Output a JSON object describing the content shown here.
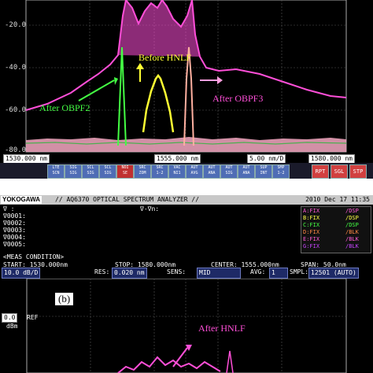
{
  "top": {
    "y_ticks": [
      "-20.0",
      "-40.0",
      "-60.0",
      "-80.0"
    ],
    "x_start": "1530.000",
    "x_center": "1555.000",
    "x_span_div": "5.00",
    "x_end": "1580.000",
    "x_unit": "nm",
    "x_div_unit": "nm/D",
    "annotations": {
      "before_hnlf": "Before HNLF",
      "after_obpf2": "After OBPF2",
      "after_obpf3": "After OBPF3"
    },
    "softkeys": [
      "LTE\nSCN",
      "SIG\nSIG",
      "SCL\nSIG",
      "SCL\nSIG",
      "NOI\nSE",
      "SRC\nZOM",
      "SRC\n1-2",
      "VAC\nNI1",
      "AUT\nAVG",
      "AUT\nANA",
      "AUT\nSIG",
      "AUT\nANA",
      "SUP\nINT",
      "SMP\n1-2"
    ],
    "right_keys": [
      "RPT",
      "SGL",
      "STP"
    ]
  },
  "bottom": {
    "logo": "YOKOGAWA",
    "title": "// AQ6370 OPTICAL SPECTRUM ANALYZER //",
    "datetime": "2010 Dec 17 11:35",
    "markers": [
      "∇ :",
      "∇0001:",
      "∇0002:",
      "∇0003:",
      "∇0004:",
      "∇0005:"
    ],
    "marker_diff": "∇-∇n:",
    "traces": [
      {
        "label": "A:FIX",
        "mode": "/DSP",
        "color": "#ff5bd6"
      },
      {
        "label": "B:FIX",
        "mode": "/DSP",
        "color": "#ffff44"
      },
      {
        "label": "C:FIX",
        "mode": "/DSP",
        "color": "#44ff44"
      },
      {
        "label": "D:FIX",
        "mode": "/BLK",
        "color": "#ff8844"
      },
      {
        "label": "E:FIX",
        "mode": "/BLK",
        "color": "#ff5bd6"
      },
      {
        "label": "G:FIX",
        "mode": "/BLK",
        "color": "#c844ff"
      }
    ],
    "meas_condition": "<MEAS CONDITION>",
    "start": "START: 1530.000nm",
    "stop": "STOP: 1580.000nm",
    "center": "CENTER: 1555.000nm",
    "span": "SPAN:   50.0nm",
    "scale": "10.0",
    "scale_unit": "dB/D",
    "res_label": "RES:",
    "res_value": "0.020",
    "res_unit": "nm",
    "sens_label": "SENS:",
    "sens_value": "MID",
    "avg_label": "AVG:",
    "avg_value": "1",
    "smpl_label": "SMPL:",
    "smpl_value": "12501 (AUTO)",
    "ref_value": "0.0",
    "ref_label": "REF",
    "ref_unit": "dBm",
    "panel_label": "(b)",
    "after_hnlf": "After HNLF"
  }
}
